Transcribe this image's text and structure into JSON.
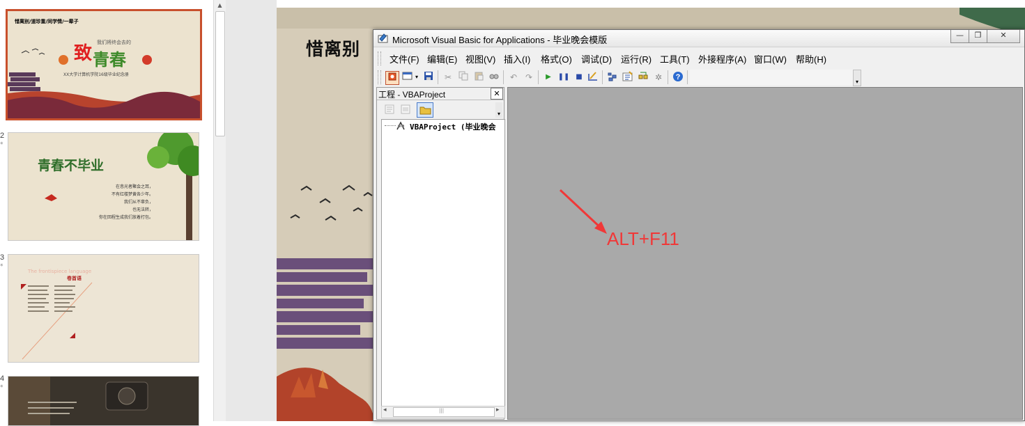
{
  "thumbnails": [
    {
      "num": "",
      "star": "",
      "title": "惜离别/道珍重/同学情/一辈子",
      "line1": "我们将终会去的",
      "big1": "致",
      "big2": "青春",
      "subtitle": "XX大学计算机学院16级毕业纪念册"
    },
    {
      "num": "2",
      "star": "*",
      "title": "青春不毕业",
      "poem": [
        "在悲光者聚会之耳，",
        "不有红楼梦黄各少年。",
        "我们从不辜负，",
        "也无法转，",
        "你在回程生成我们放着打包。"
      ]
    },
    {
      "num": "3",
      "star": "*",
      "heading_en": "The frontispiece language",
      "heading_cn": "卷首语"
    },
    {
      "num": "4",
      "star": "*"
    }
  ],
  "slide": {
    "title": "惜离别"
  },
  "vba": {
    "title": "Microsoft Visual Basic for Applications - 毕业晚会模版",
    "window_buttons": {
      "minimize": "—",
      "restore": "❐",
      "close": "✕"
    },
    "menus": [
      "文件(F)",
      "编辑(E)",
      "视图(V)",
      "插入(I)",
      "格式(O)",
      "调试(D)",
      "运行(R)",
      "工具(T)",
      "外接程序(A)",
      "窗口(W)",
      "帮助(H)"
    ],
    "project_pane": {
      "header": "工程 - VBAProject",
      "close": "✕",
      "tree_item": "VBAProject (毕业晚会",
      "scroll_left": "◂",
      "scroll_right": "▸",
      "scroll_grip": "|||"
    },
    "annotation": "ALT+F11",
    "colors": {
      "annotation": "#f03838",
      "code_bg": "#a9a9a9"
    }
  },
  "scrollbar": {
    "up": "▲"
  }
}
